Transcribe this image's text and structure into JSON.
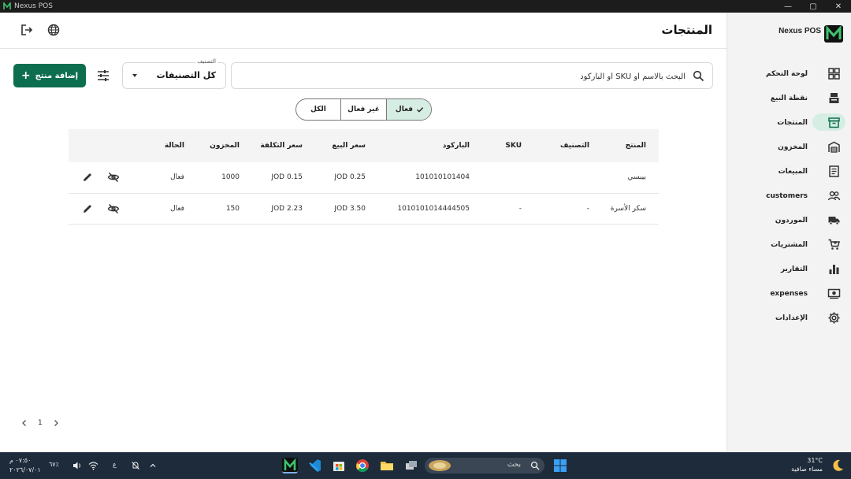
{
  "window": {
    "title": "Nexus POS",
    "controls": [
      "—",
      "▢",
      "✕"
    ]
  },
  "sidebar": {
    "brand": "Nexus POS",
    "items": [
      {
        "label": "لوحة التحكم",
        "icon": "dashboard-icon"
      },
      {
        "label": "نقطة البيع",
        "icon": "pos-icon"
      },
      {
        "label": "المنتجات",
        "icon": "products-icon",
        "active": true
      },
      {
        "label": "المخزون",
        "icon": "warehouse-icon"
      },
      {
        "label": "المبيعات",
        "icon": "receipt-icon"
      },
      {
        "label": "customers",
        "icon": "people-icon"
      },
      {
        "label": "الموردون",
        "icon": "truck-icon"
      },
      {
        "label": "المشتريات",
        "icon": "cart-icon"
      },
      {
        "label": "التقارير",
        "icon": "bar-chart-icon"
      },
      {
        "label": "expenses",
        "icon": "money-icon"
      },
      {
        "label": "الإعدادات",
        "icon": "gear-icon"
      }
    ]
  },
  "header": {
    "title": "المنتجات"
  },
  "toolbar": {
    "search_placeholder": "البحث بالاسم أو SKU أو الباركود",
    "category_label": "التصنيف",
    "category_value": "كل التصنيفات",
    "add_label": "إضافة منتج"
  },
  "status_filter": {
    "active": "فعال",
    "inactive": "غير فعال",
    "all": "الكل",
    "selected": "active"
  },
  "table": {
    "columns": [
      "المنتج",
      "التصنيف",
      "SKU",
      "الباركود",
      "سعر البيع",
      "سعر التكلفة",
      "المخزون",
      "الحالة"
    ],
    "rows": [
      [
        "بيبسي",
        "",
        "",
        "101010101404",
        "JOD 0.25",
        "JOD 0.15",
        "1000",
        "فعال"
      ],
      [
        "سكر الأسرة",
        "-",
        "-",
        "1010101014444505",
        "JOD 3.50",
        "JOD 2.23",
        "150",
        "فعال"
      ]
    ]
  },
  "pagination": {
    "page": "1"
  },
  "taskbar": {
    "time": "٠٧:٥٠ م",
    "date": "٢٠٢٦/٠٧/٠١",
    "battery": "٦٧٪",
    "lang": "ع",
    "search_text": "بحث",
    "temperature": "31°C",
    "weather_text": "مساء صافية"
  },
  "colors": {
    "brand_green": "#0d6e4f",
    "active_pill": "#d6ede3",
    "taskbar": "#1d2b3b"
  }
}
